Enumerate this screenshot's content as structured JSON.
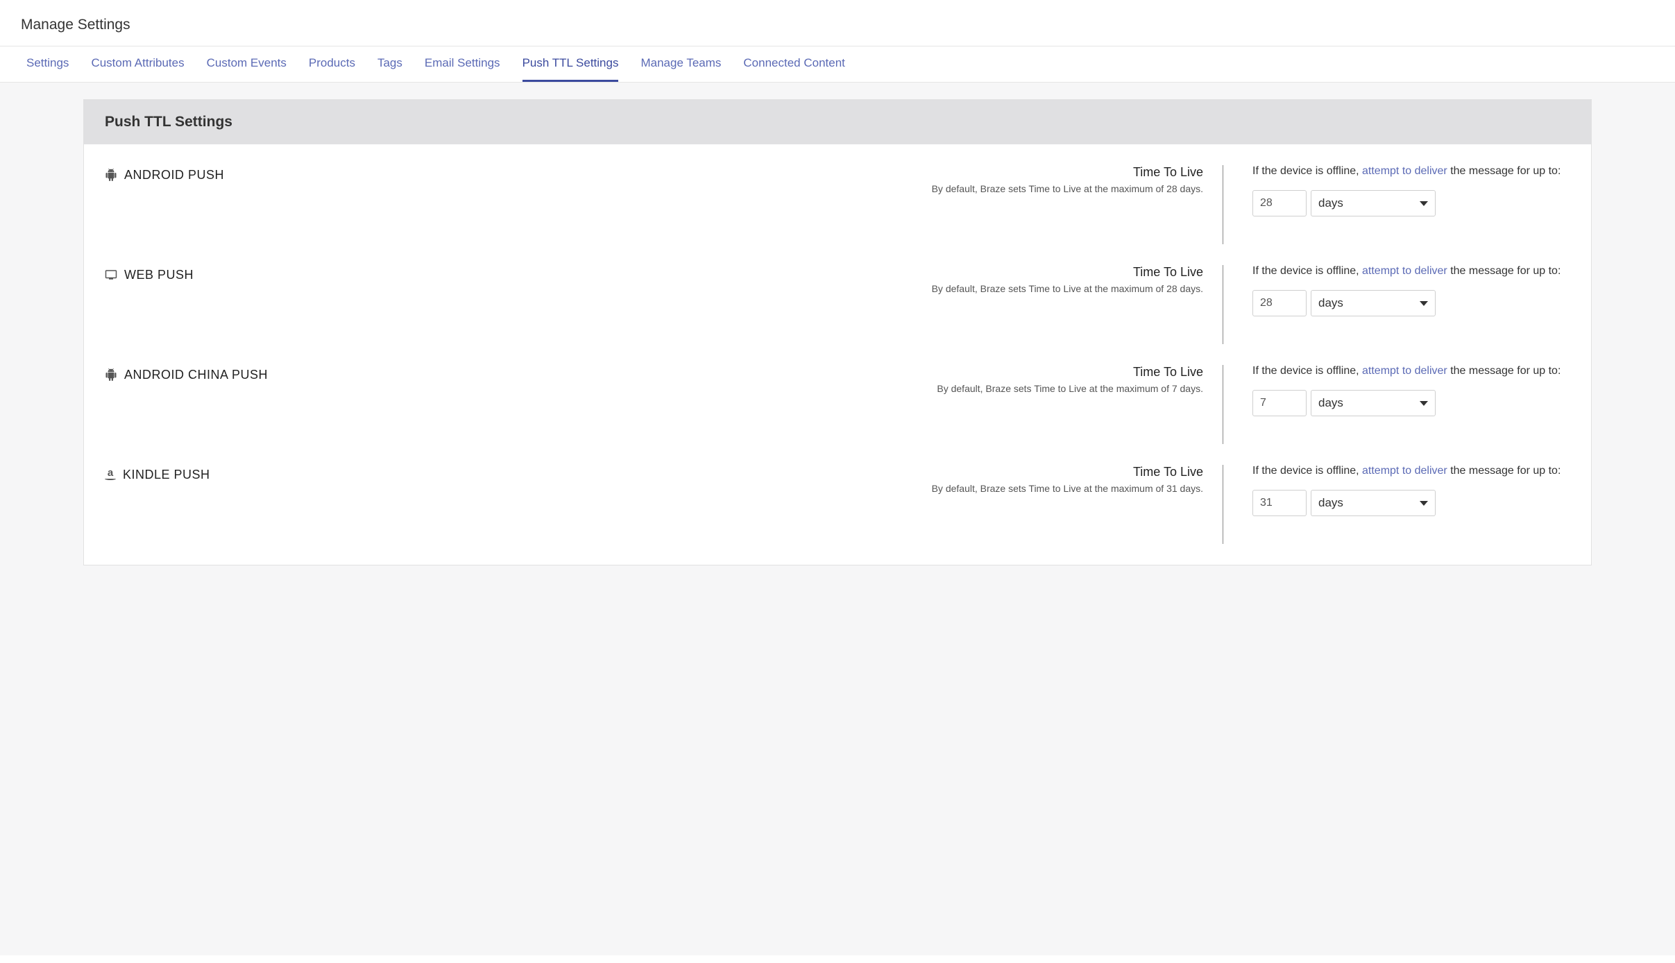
{
  "page_title": "Manage Settings",
  "tabs": [
    {
      "label": "Settings"
    },
    {
      "label": "Custom Attributes"
    },
    {
      "label": "Custom Events"
    },
    {
      "label": "Products"
    },
    {
      "label": "Tags"
    },
    {
      "label": "Email Settings"
    },
    {
      "label": "Push TTL Settings",
      "active": true
    },
    {
      "label": "Manage Teams"
    },
    {
      "label": "Connected Content"
    }
  ],
  "panel_title": "Push TTL Settings",
  "ttl_heading": "Time To Live",
  "deliver_prefix": "If the device is offline, ",
  "deliver_link": "attempt to deliver",
  "deliver_suffix": " the message for up to:",
  "rows": [
    {
      "name": "ANDROID PUSH",
      "icon": "android",
      "desc": "By default, Braze sets Time to Live at the maximum of 28 days.",
      "value": "28",
      "unit": "days"
    },
    {
      "name": "WEB PUSH",
      "icon": "monitor",
      "desc": "By default, Braze sets Time to Live at the maximum of 28 days.",
      "value": "28",
      "unit": "days"
    },
    {
      "name": "ANDROID CHINA PUSH",
      "icon": "android",
      "desc": "By default, Braze sets Time to Live at the maximum of 7 days.",
      "value": "7",
      "unit": "days"
    },
    {
      "name": "KINDLE PUSH",
      "icon": "amazon",
      "desc": "By default, Braze sets Time to Live at the maximum of 31 days.",
      "value": "31",
      "unit": "days"
    }
  ]
}
